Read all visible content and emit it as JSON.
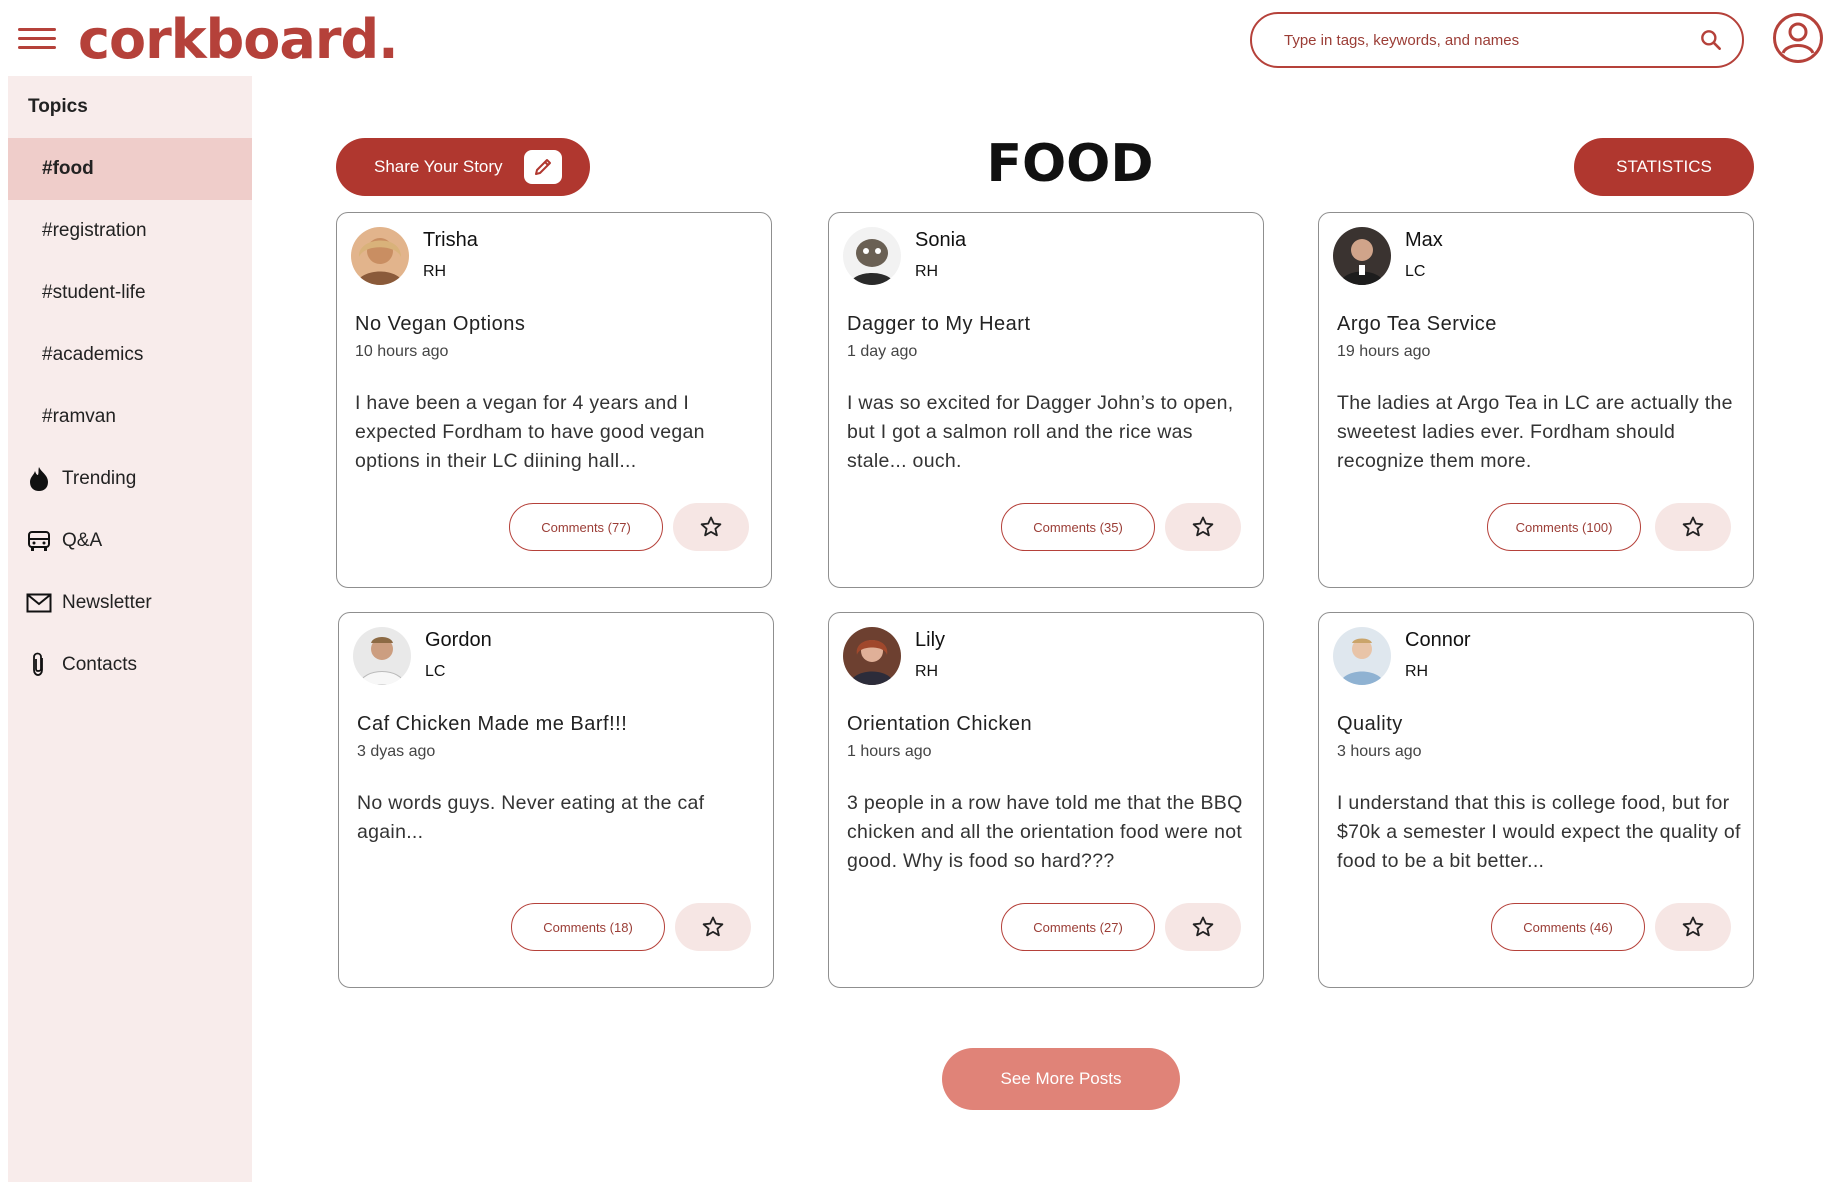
{
  "header": {
    "logo": "corkboard.",
    "search_placeholder": "Type in tags, keywords, and names"
  },
  "sidebar": {
    "title": "Topics",
    "topics": [
      "#food",
      "#registration",
      "#student-life",
      "#academics",
      "#ramvan"
    ],
    "nav": [
      {
        "label": "Trending",
        "icon": "fire-icon"
      },
      {
        "label": "Q&A",
        "icon": "bus-icon"
      },
      {
        "label": "Newsletter",
        "icon": "mail-icon"
      },
      {
        "label": "Contacts",
        "icon": "paperclip-icon"
      }
    ]
  },
  "main": {
    "share_label": "Share Your Story",
    "page_title": "FOOD",
    "stats_label": "STATISTICS",
    "see_more_label": "See More Posts"
  },
  "posts": [
    {
      "name": "Trisha",
      "dorm": "RH",
      "title": "No Vegan Options",
      "time": "10 hours ago",
      "body": "I have been a vegan for 4 years and I expected Fordham to have good vegan options in their LC diining hall...",
      "comments": "Comments (77)"
    },
    {
      "name": "Sonia",
      "dorm": "RH",
      "title": "Dagger to My Heart",
      "time": "1 day ago",
      "body": "I was so excited for Dagger John’s to open, but I got a salmon roll and the rice was stale... ouch.",
      "comments": "Comments (35)"
    },
    {
      "name": "Max",
      "dorm": "LC",
      "title": "Argo Tea Service",
      "time": "19 hours ago",
      "body": "The ladies at Argo Tea in LC are actually the sweetest ladies ever.  Fordham should recognize them more.",
      "comments": "Comments (100)"
    },
    {
      "name": "Gordon",
      "dorm": "LC",
      "title": "Caf Chicken Made me Barf!!!",
      "time": "3 dyas ago",
      "body": "No words guys. Never eating at the caf again...",
      "comments": "Comments (18)"
    },
    {
      "name": "Lily",
      "dorm": "RH",
      "title": "Orientation Chicken",
      "time": "1 hours ago",
      "body": "3 people in a row have told me that the BBQ chicken and all the orientation food were not good.  Why is food so hard???",
      "comments": "Comments (27)"
    },
    {
      "name": "Connor",
      "dorm": "RH",
      "title": "Quality",
      "time": "3 hours ago",
      "body": "I understand that this is college food, but for $70k a semester I would expect the quality of food to be a bit better...",
      "comments": "Comments (46)"
    }
  ],
  "colors": {
    "brand": "#b5413a",
    "button": "#b0372f",
    "see_more": "#e08378",
    "sidebar_bg": "#f8eceb",
    "active_topic": "#efcdca"
  }
}
